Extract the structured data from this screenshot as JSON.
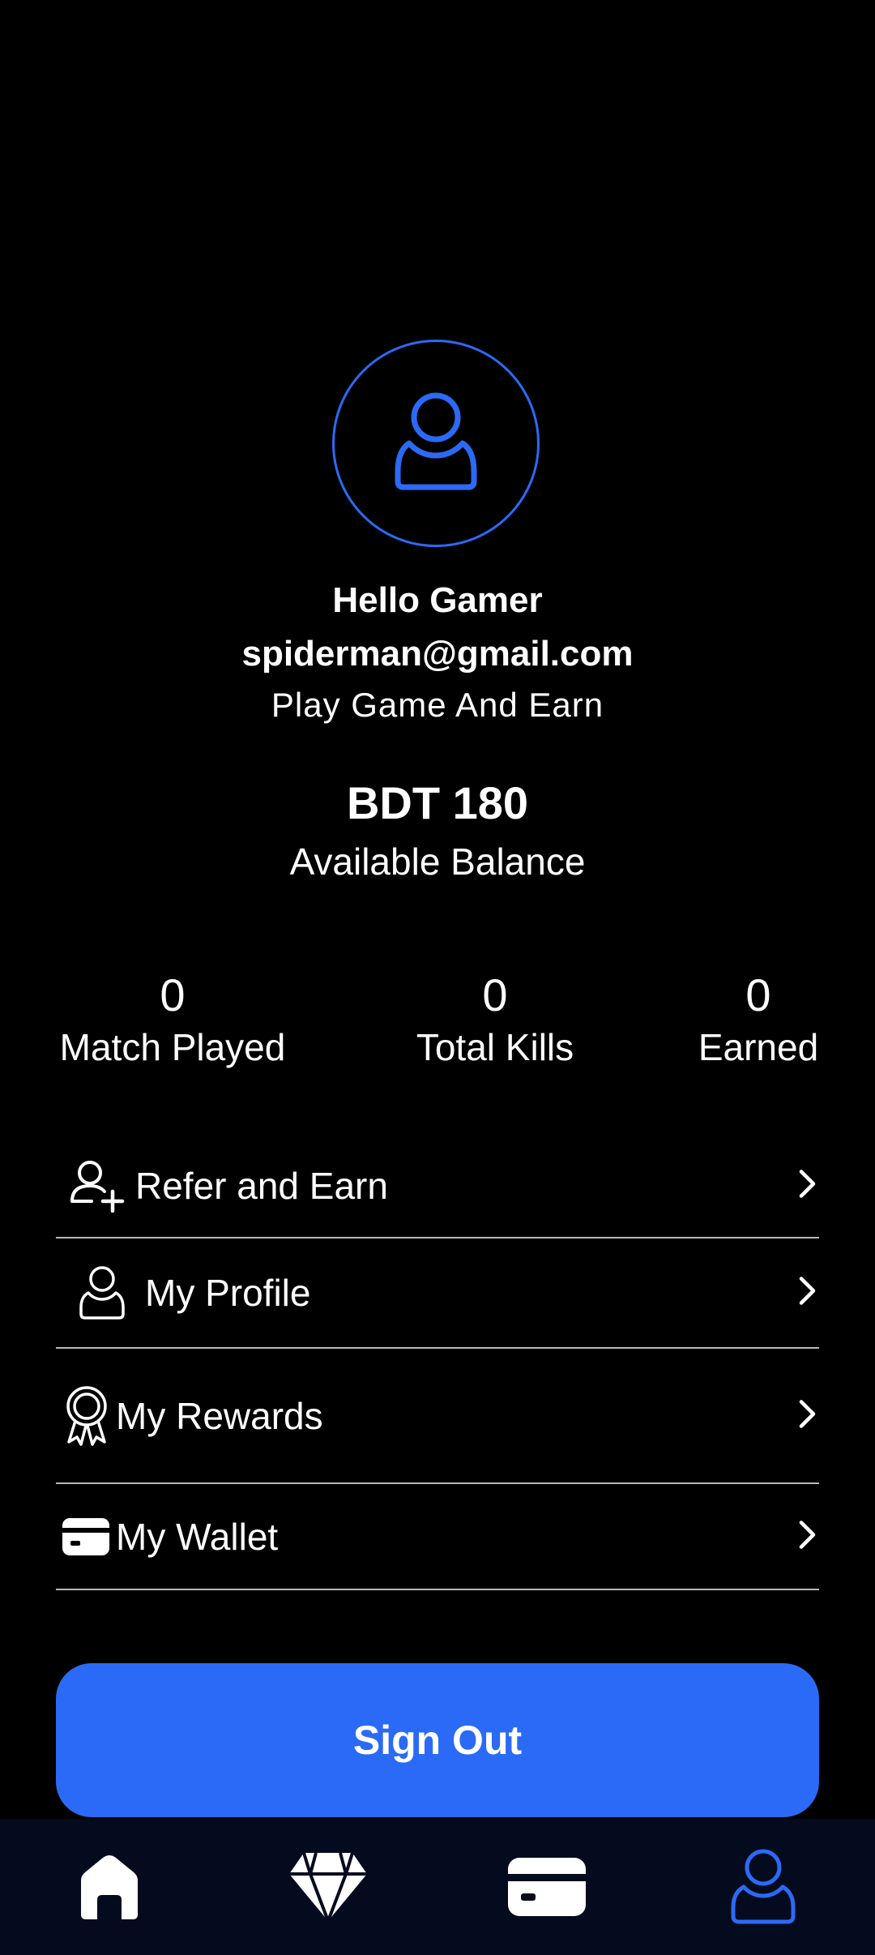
{
  "profile": {
    "greeting": "Hello Gamer",
    "email": "spiderman@gmail.com",
    "tagline": "Play Game And Earn",
    "avatar_icon": "user-icon"
  },
  "balance": {
    "amount": "BDT 180",
    "label": "Available Balance"
  },
  "stats": [
    {
      "value": "0",
      "label": "Match Played"
    },
    {
      "value": "0",
      "label": "Total Kills"
    },
    {
      "value": "0",
      "label": "Earned"
    }
  ],
  "menu": [
    {
      "label": "Refer and Earn",
      "icon": "add-user-icon"
    },
    {
      "label": "My Profile",
      "icon": "user-icon"
    },
    {
      "label": "My Rewards",
      "icon": "award-ribbon-icon"
    },
    {
      "label": "My Wallet",
      "icon": "wallet-card-icon"
    }
  ],
  "sign_out_label": "Sign Out",
  "bottom_nav": [
    {
      "icon": "home-icon",
      "active": false
    },
    {
      "icon": "diamond-icon",
      "active": false
    },
    {
      "icon": "wallet-card-icon",
      "active": false
    },
    {
      "icon": "user-icon",
      "active": true
    }
  ],
  "colors": {
    "accent": "#2b6af6",
    "background": "#000000",
    "nav_background": "#050b1e",
    "text": "#ffffff",
    "divider": "#b8b8b8"
  }
}
